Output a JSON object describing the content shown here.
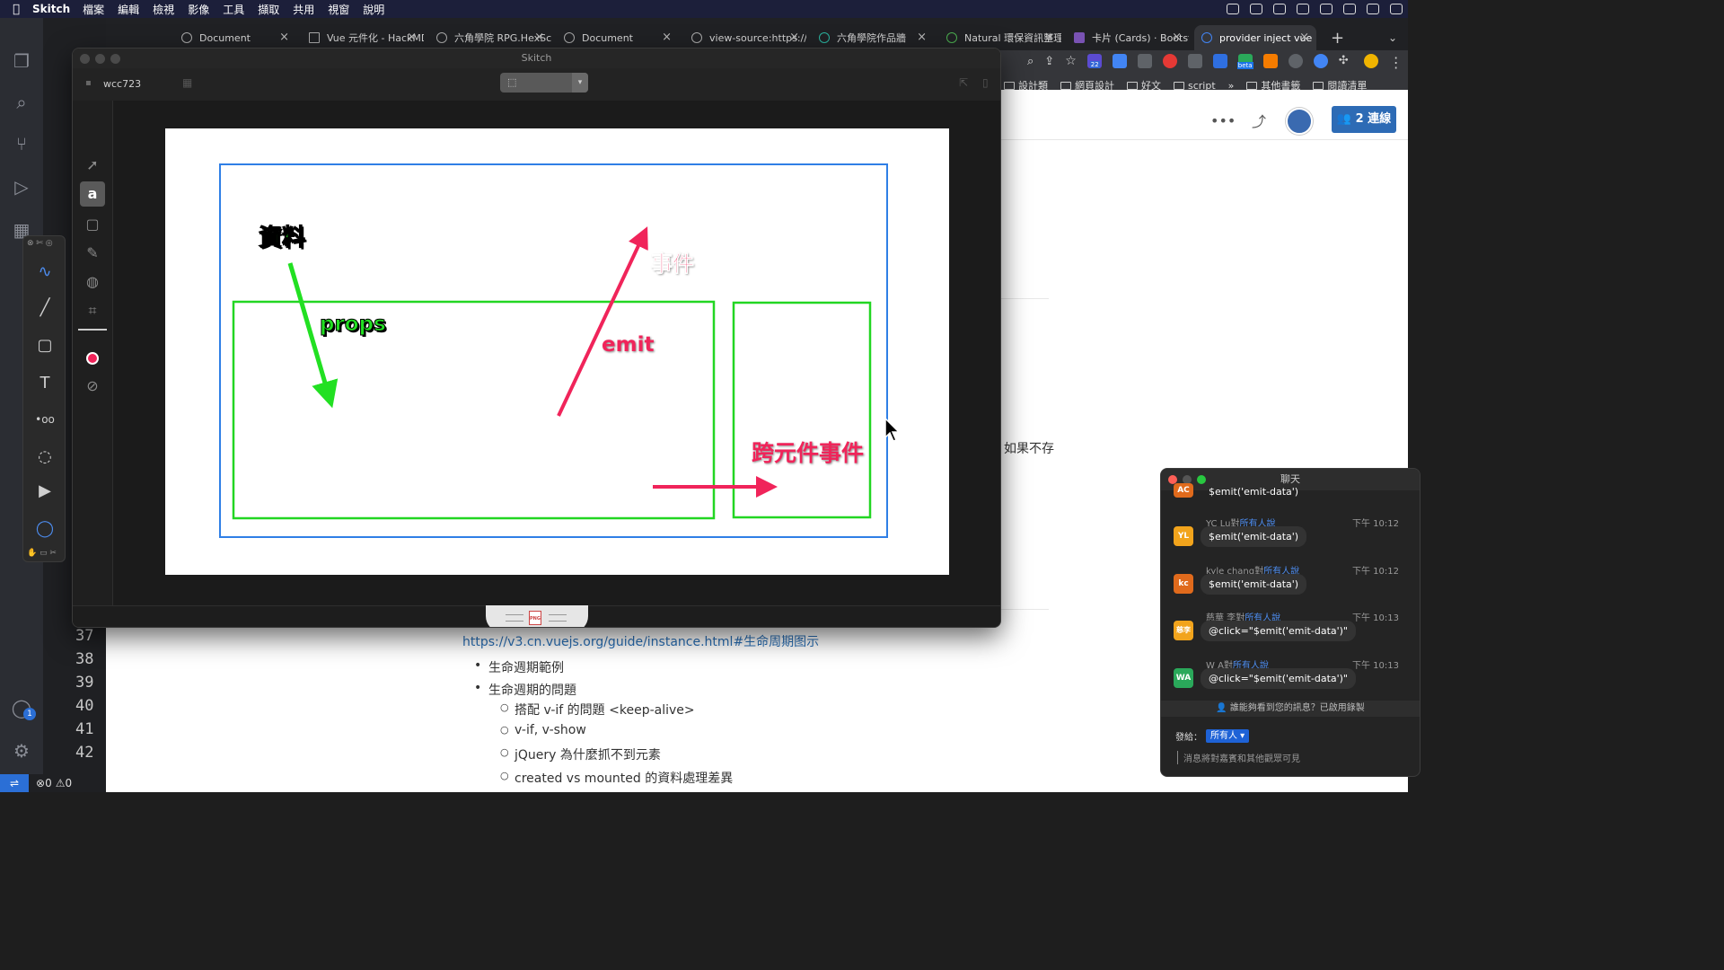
{
  "menubar": {
    "app": "Skitch",
    "items": [
      "檔案",
      "編輯",
      "檢視",
      "影像",
      "工具",
      "擷取",
      "共用",
      "視窗",
      "說明"
    ]
  },
  "chrome": {
    "tabs": [
      {
        "title": "Document"
      },
      {
        "title": "Vue 元件化 - HackMD"
      },
      {
        "title": "六角學院 RPG.HexSchool"
      },
      {
        "title": "Document"
      },
      {
        "title": "view-source:https://"
      },
      {
        "title": "六角學院作品牆"
      },
      {
        "title": "Natural 環保資訊整理"
      },
      {
        "title": "卡片 (Cards) · Bootstrap"
      },
      {
        "title": "provider inject vue"
      }
    ],
    "bookmarks": [
      "設計類",
      "網頁設計",
      "好文",
      "script",
      "»",
      "其他書籤",
      "閱讀清單"
    ],
    "ext_badge": "22",
    "ext_beta": "beta"
  },
  "hackmd": {
    "connect_label": "2 連線",
    "partial_text": "如果不存",
    "link_text": "https://v3.cn.vuejs.org/guide/instance.html#生命周期图示",
    "bullets": [
      "生命週期範例",
      "生命週期的問題"
    ],
    "sub_bullets": [
      "搭配 v-if 的問題 <keep-alive>",
      "v-if, v-show",
      "jQuery 為什麼抓不到元素",
      "created vs mounted 的資料處理差異"
    ]
  },
  "vscode": {
    "line_numbers": [
      "37",
      "38",
      "39",
      "40",
      "41",
      "42"
    ],
    "status": {
      "errors": "0",
      "warnings": "0"
    },
    "account_badge": "1"
  },
  "skitch": {
    "window_title": "Skitch",
    "user": "wcc723",
    "drag_label": "PNG",
    "annotations": {
      "data": "資料",
      "props": "props",
      "event": "事件",
      "emit": "emit",
      "cross_event": "跨元件事件"
    },
    "colors": {
      "green": "#22e022",
      "pink": "#f0245a",
      "blue": "#2f7fe6",
      "box_green": "#22d622"
    }
  },
  "chat": {
    "title": "聊天",
    "messages": [
      {
        "avatar": "AC",
        "avatar_color": "#e06a1c",
        "sender": "",
        "target": "",
        "time": "",
        "text": "$emit('emit-data')"
      },
      {
        "avatar": "YL",
        "avatar_color": "#f2a41c",
        "sender": "YC Lu",
        "target": "所有人說",
        "time": "下午 10:12",
        "text": "$emit('emit-data')"
      },
      {
        "avatar": "kc",
        "avatar_color": "#e06a1c",
        "sender": "kyle chang",
        "target": "所有人說",
        "time": "下午 10:12",
        "text": "$emit('emit-data')"
      },
      {
        "avatar": "慈李",
        "avatar_color": "#f2a41c",
        "sender": "慈華 李",
        "target": "所有人說",
        "time": "下午 10:13",
        "text": "@click=\"$emit('emit-data')\""
      },
      {
        "avatar": "WA",
        "avatar_color": "#2aa85a",
        "sender": "W A",
        "target": "所有人說",
        "time": "下午 10:13",
        "text": "@click=\"$emit('emit-data')\""
      }
    ],
    "notice": "誰能夠看到您的訊息？已啟用錄製",
    "to_label": "發給：",
    "to_value": "所有人 ▾",
    "input_placeholder": "消息將對嘉賓和其他觀眾可見"
  }
}
